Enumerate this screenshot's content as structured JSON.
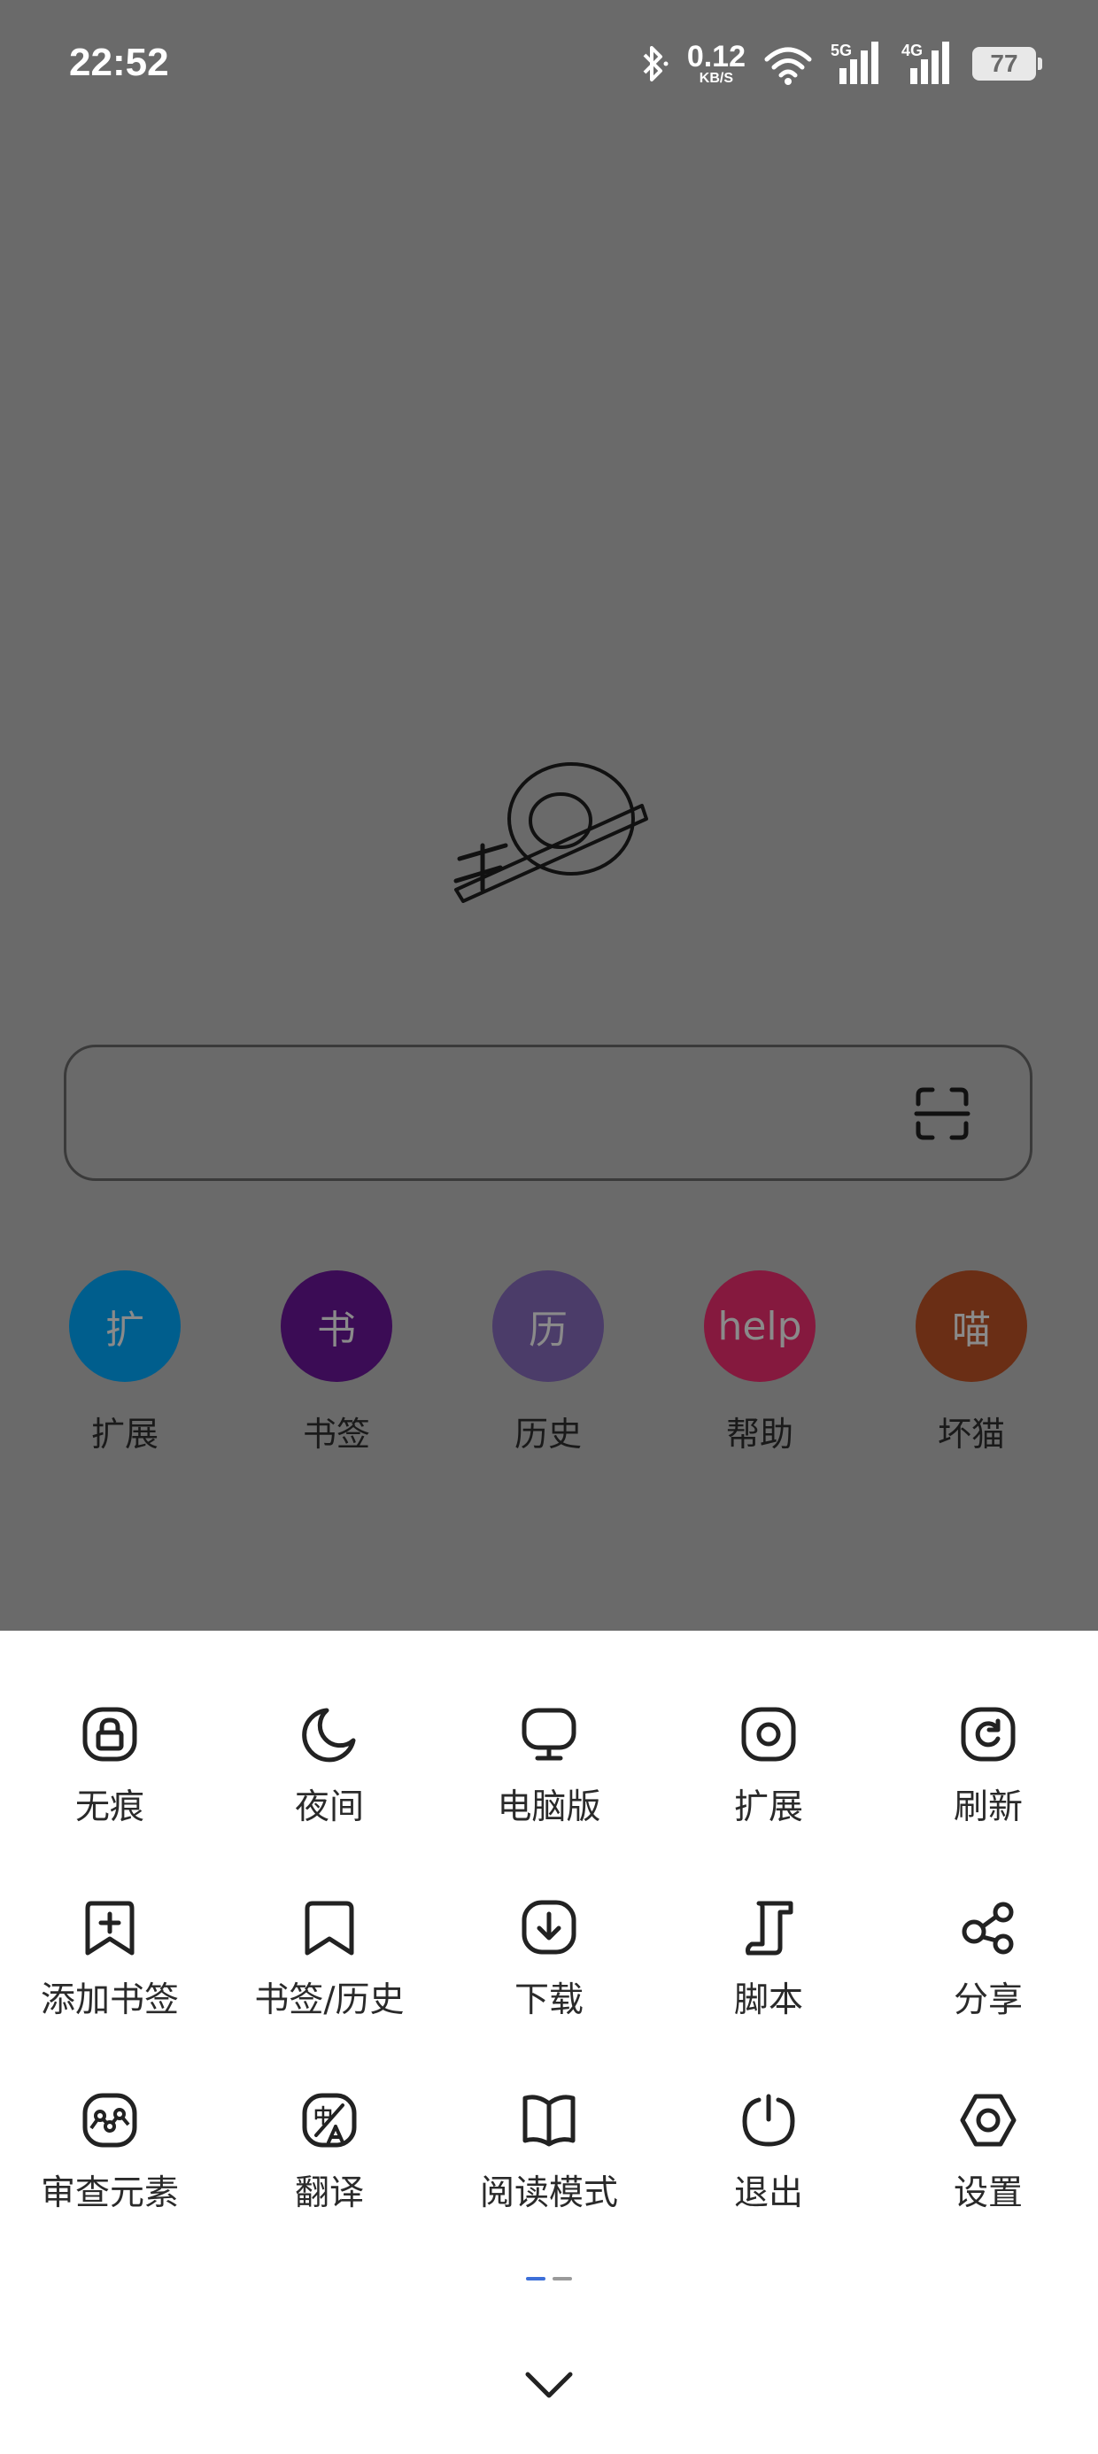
{
  "status_bar": {
    "time": "22:52",
    "net_speed_value": "0.12",
    "net_speed_unit": "KB/S",
    "signal_5g": "5G",
    "signal_4g": "4G",
    "battery": "77",
    "icons": [
      "bluetooth-icon",
      "wifi-icon",
      "signal-5g-icon",
      "signal-4g-icon",
      "battery-icon"
    ]
  },
  "search": {
    "value": "",
    "scan_icon": "scan-icon"
  },
  "shortcuts": [
    {
      "glyph": "扩",
      "label": "扩展",
      "color": "#005e8d"
    },
    {
      "glyph": "书",
      "label": "书签",
      "color": "#3b0c55"
    },
    {
      "glyph": "历",
      "label": "历史",
      "color": "#4b3c69"
    },
    {
      "glyph": "help",
      "label": "帮助",
      "color": "#85193e"
    },
    {
      "glyph": "喵",
      "label": "坏猫",
      "color": "#6a2e15"
    }
  ],
  "menu": {
    "items": [
      {
        "label": "无痕",
        "icon": "lock-icon"
      },
      {
        "label": "夜间",
        "icon": "moon-icon"
      },
      {
        "label": "电脑版",
        "icon": "monitor-icon"
      },
      {
        "label": "扩展",
        "icon": "extension-icon"
      },
      {
        "label": "刷新",
        "icon": "refresh-icon"
      },
      {
        "label": "添加书签",
        "icon": "add-bookmark-icon"
      },
      {
        "label": "书签/历史",
        "icon": "bookmark-icon"
      },
      {
        "label": "下载",
        "icon": "download-icon"
      },
      {
        "label": "脚本",
        "icon": "script-icon"
      },
      {
        "label": "分享",
        "icon": "share-icon"
      },
      {
        "label": "审查元素",
        "icon": "inspect-icon"
      },
      {
        "label": "翻译",
        "icon": "translate-icon"
      },
      {
        "label": "阅读模式",
        "icon": "book-open-icon"
      },
      {
        "label": "退出",
        "icon": "power-icon"
      },
      {
        "label": "设置",
        "icon": "settings-icon"
      }
    ],
    "page_count": 2,
    "active_page": 1
  },
  "colors": {
    "overlay": "#6a6a6a",
    "sheet": "#ffffff",
    "pager_active": "#3d6fd8"
  }
}
